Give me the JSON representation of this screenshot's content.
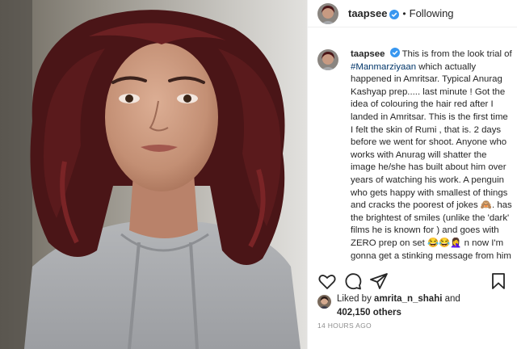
{
  "header": {
    "username": "taapsee",
    "separator": "•",
    "follow_status": "Following"
  },
  "caption": {
    "username": "taapsee",
    "text_before_tag": "This is from the look trial of",
    "hashtag": "#Manmarziyaan",
    "text_after_tag": "which actually happened in Amritsar. Typical Anurag Kashyap prep..... last minute ! Got the idea of colouring the hair red after I landed in Amritsar. This is the first time I felt the skin of Rumi , that is. 2 days before we went for shoot. Anyone who works with Anurag will shatter the image he/she has built about him over years of watching his work. A penguin who gets happy with smallest of things and cracks the poorest of jokes 🙈. has the brightest of smiles (unlike the 'dark' films he is known for ) and goes with ZERO prep on set 😂😂🤦‍♀️ n now I'm gonna get a stinking message from him as soon as he reads this but I... I love him."
  },
  "actions": {
    "icons": [
      "heart-icon",
      "comment-icon",
      "share-icon",
      "save-icon"
    ]
  },
  "likes": {
    "prefix": "Liked by",
    "user": "amrita_n_shahi",
    "conjunction": "and",
    "count": "402,150 others"
  },
  "timestamp": "14 HOURS AGO",
  "colors": {
    "verified": "#3897f0",
    "text": "#262626",
    "muted": "#8e8e8e",
    "hair": "#5a1a1c",
    "sweater": "#a7a9ac"
  }
}
